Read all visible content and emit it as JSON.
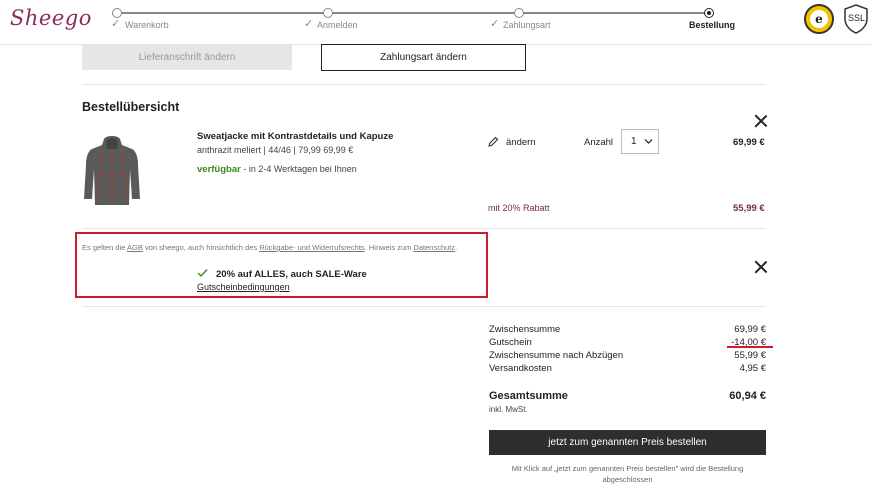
{
  "header": {
    "logo": "Sheego",
    "steps": [
      {
        "label": "Warenkorb"
      },
      {
        "label": "Anmelden"
      },
      {
        "label": "Zahlungsart"
      },
      {
        "label": "Bestellung"
      }
    ],
    "ssl_label": "SSL",
    "trust_badge_letter": "e"
  },
  "top_buttons": {
    "address": "Lieferanschrift ändern",
    "payment": "Zahlungsart ändern"
  },
  "order_overview": {
    "title": "Bestellübersicht",
    "product": {
      "name": "Sweatjacke mit Kontrastdetails und Kapuze",
      "details": "anthrazit meliert | 44/46 | 79,99 69,99 €",
      "availability": "verfügbar",
      "delivery": " - in 2-4 Werktagen bei Ihnen",
      "edit_label": "ändern",
      "qty_label": "Anzahl",
      "qty_value": "1",
      "price": "69,99 €",
      "discount_label": "mit 20% Rabatt",
      "discount_price": "55,99 €"
    }
  },
  "voucher": {
    "terms_prefix": "Es gelten die ",
    "terms_agb": "AGB",
    "terms_mid": " von sheego, auch hinsichtlich des ",
    "terms_rights": "Rückgabe- und Widerrufsrechts",
    "terms_hint": ". Hinweis zum ",
    "terms_privacy": "Datenschutz",
    "terms_end": ".",
    "title": "20% auf ALLES, auch SALE-Ware",
    "conditions": "Gutscheinbedingungen"
  },
  "summary": {
    "rows": [
      {
        "label": "Zwischensumme",
        "value": "69,99 €"
      },
      {
        "label": "Gutschein",
        "value": "-14,00 €"
      },
      {
        "label": "Zwischensumme nach Abzügen",
        "value": "55,99 €"
      },
      {
        "label": "Versandkosten",
        "value": "4,95 €"
      }
    ],
    "total_label": "Gesamtsumme",
    "total_value": "60,94 €",
    "vat": "inkl. MwSt.",
    "order_button": "jetzt zum genannten Preis bestellen",
    "note": "Mit Klick auf „jetzt zum genannten Preis bestellen\" wird die Bestellung abgeschlossen"
  },
  "colors": {
    "brand": "#8a2b5a",
    "available": "#3a8a1c",
    "discount": "#7a2a55",
    "highlight_border": "#d11a2a",
    "order_button": "#2e2e2e"
  }
}
